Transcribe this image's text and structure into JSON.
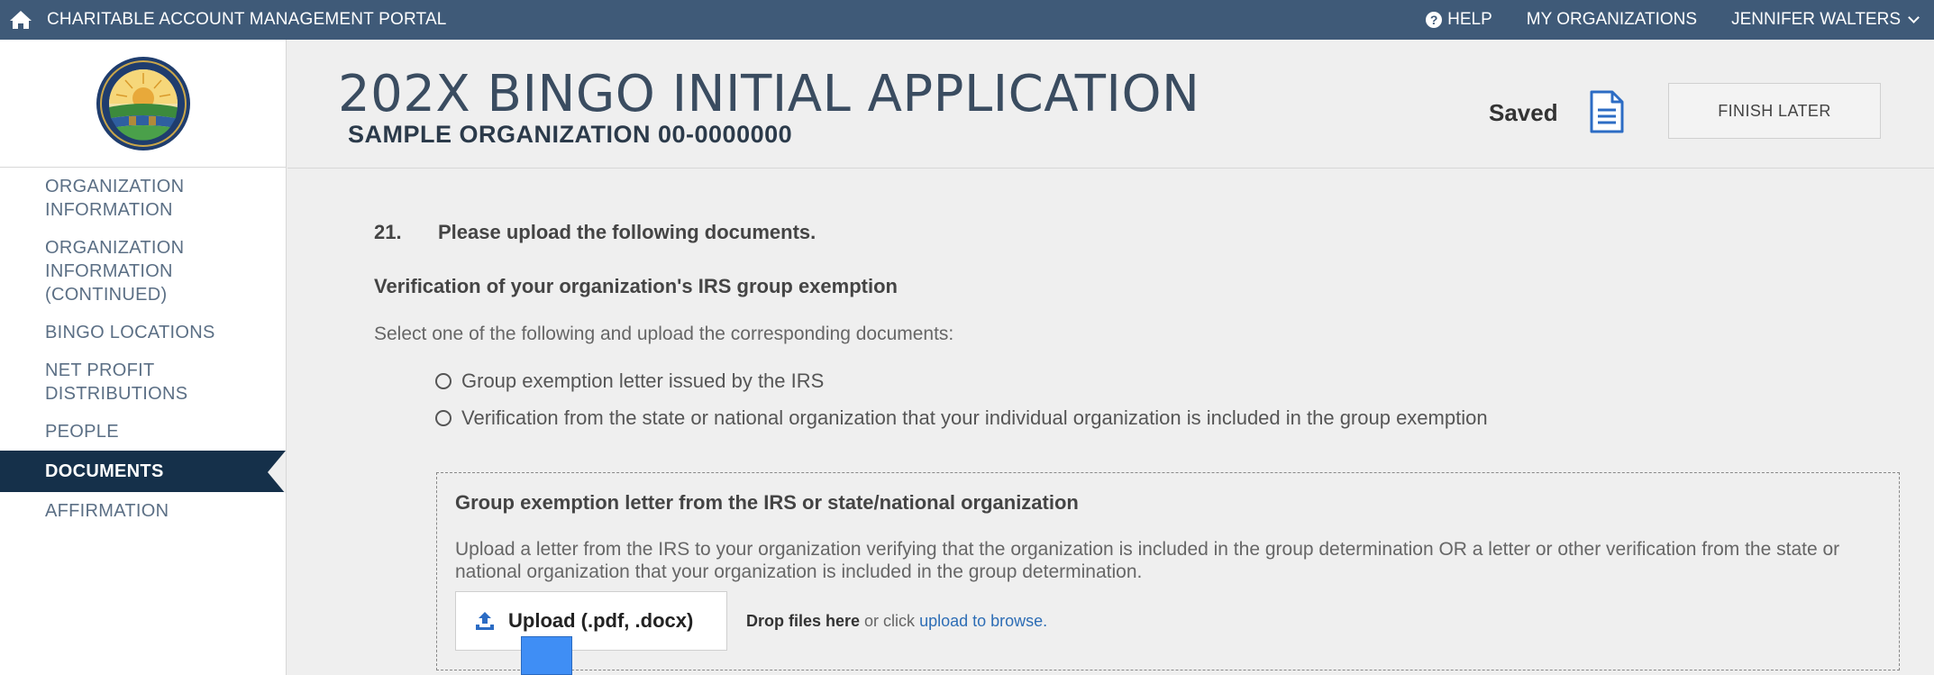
{
  "topbar": {
    "portal_title": "CHARITABLE ACCOUNT MANAGEMENT PORTAL",
    "help": "HELP",
    "my_organizations": "MY ORGANIZATIONS",
    "user_name": "JENNIFER WALTERS"
  },
  "sidebar": {
    "items": [
      {
        "label": "ORGANIZATION INFORMATION",
        "active": false
      },
      {
        "label": "ORGANIZATION INFORMATION (CONTINUED)",
        "active": false
      },
      {
        "label": "BINGO LOCATIONS",
        "active": false
      },
      {
        "label": "NET PROFIT DISTRIBUTIONS",
        "active": false
      },
      {
        "label": "PEOPLE",
        "active": false
      },
      {
        "label": "DOCUMENTS",
        "active": true
      },
      {
        "label": "AFFIRMATION",
        "active": false
      }
    ]
  },
  "header": {
    "title": "202X BINGO INITIAL APPLICATION",
    "subtitle": "SAMPLE ORGANIZATION 00-0000000",
    "saved": "Saved",
    "finish_later": "FINISH LATER"
  },
  "question": {
    "number": "21.",
    "text": "Please upload the following documents.",
    "section_heading": "Verification of your organization's IRS group exemption",
    "instruction": "Select one of the following and upload the corresponding documents:",
    "options": [
      "Group exemption letter issued by the IRS",
      "Verification from the state or national organization that your individual organization is included in the group exemption"
    ]
  },
  "upload": {
    "title": "Group exemption letter from the IRS or state/national organization",
    "description": "Upload a letter from the IRS to your organization verifying that the organization is included in the group determination OR a letter or other verification from the state or national organization that your organization is included in the group determination.",
    "button_label": "Upload (.pdf, .docx)",
    "drop_bold": "Drop files here",
    "drop_mid": " or click ",
    "drop_link": "upload to browse."
  },
  "colors": {
    "topbar": "#3f5a78",
    "active_nav": "#15304a",
    "link": "#2d6db5",
    "icon_blue": "#2c6cc4"
  }
}
